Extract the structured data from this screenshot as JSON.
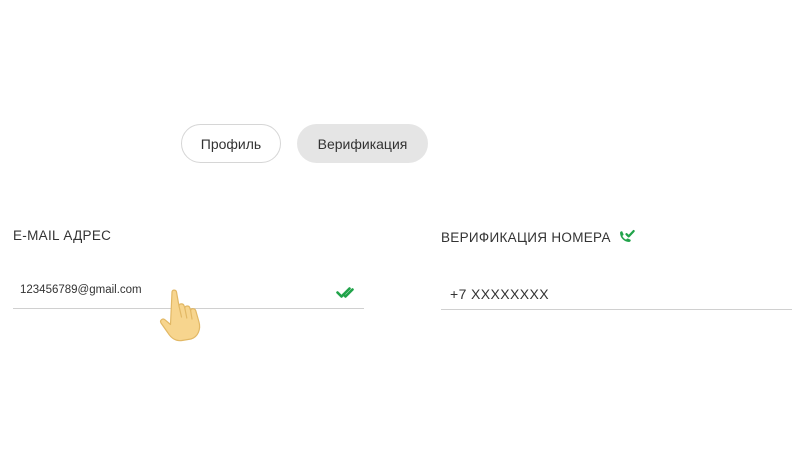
{
  "tabs": {
    "profile_label": "Профиль",
    "verification_label": "Верификация",
    "active": "verification"
  },
  "email": {
    "label": "E-MAIL АДРЕС",
    "value": "123456789@gmail.com",
    "status_icon": "double-check-icon",
    "verified": true
  },
  "phone": {
    "label": "ВЕРИФИКАЦИЯ НОМЕРА",
    "status_icon": "phone-verified-icon",
    "value": "+7 XXXXXXXX",
    "verified": true
  },
  "cursor": {
    "icon": "pointing-hand-icon"
  },
  "colors": {
    "accent_green": "#21a34a",
    "tab_active_bg": "#e5e5e5",
    "tab_border": "#d6d6d6",
    "text": "#333333",
    "field_line": "#d0d0d0",
    "hand_fill": "#f7d58e"
  }
}
